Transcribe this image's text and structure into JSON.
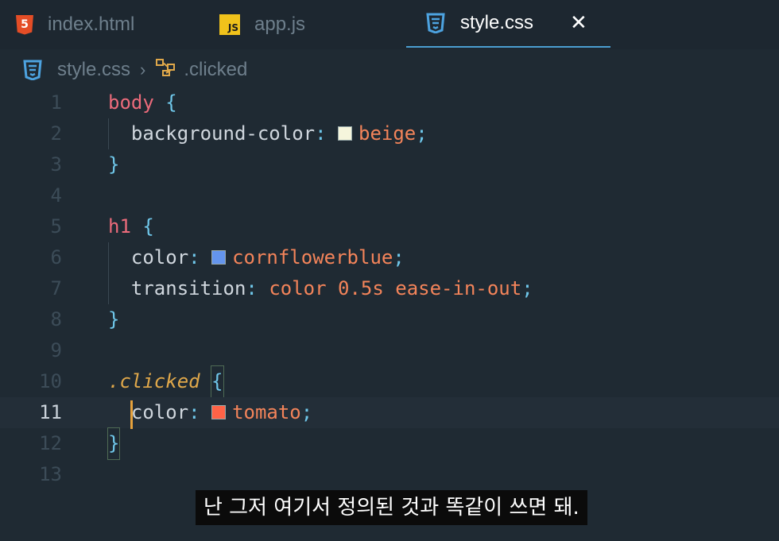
{
  "tabs": [
    {
      "label": "index.html",
      "icon": "html5-icon",
      "badge": "5"
    },
    {
      "label": "app.js",
      "icon": "js-icon",
      "badge": "JS"
    },
    {
      "label": "style.css",
      "icon": "css3-icon",
      "badge": "3",
      "active": true,
      "close": "✕"
    }
  ],
  "breadcrumb": {
    "file": "style.css",
    "separator": "›",
    "symbol": ".clicked"
  },
  "editor": {
    "line_numbers": [
      "1",
      "2",
      "3",
      "4",
      "5",
      "6",
      "7",
      "8",
      "9",
      "10",
      "11",
      "12",
      "13"
    ],
    "active_line": "11",
    "code": {
      "l1_selector": "body",
      "l1_brace": "{",
      "l2_prop": "background-color",
      "l2_colon": ":",
      "l2_value": "beige",
      "l2_semi": ";",
      "l3_brace": "}",
      "l5_selector": "h1",
      "l5_brace": "{",
      "l6_prop": "color",
      "l6_colon": ":",
      "l6_value": "cornflowerblue",
      "l6_semi": ";",
      "l7_prop": "transition",
      "l7_colon": ":",
      "l7_value": "color 0.5s ease-in-out",
      "l7_semi": ";",
      "l8_brace": "}",
      "l10_selector": ".clicked",
      "l10_brace": "{",
      "l11_prop": "color",
      "l11_colon": ":",
      "l11_value": "tomato",
      "l11_semi": ";",
      "l12_brace": "}"
    },
    "swatch_colors": {
      "beige": "#f5f5dc",
      "cornflowerblue": "#6495ed",
      "tomato": "#ff6347"
    }
  },
  "subtitle": "난 그저 여기서 정의된 것과 똑같이 쓰면 돼."
}
